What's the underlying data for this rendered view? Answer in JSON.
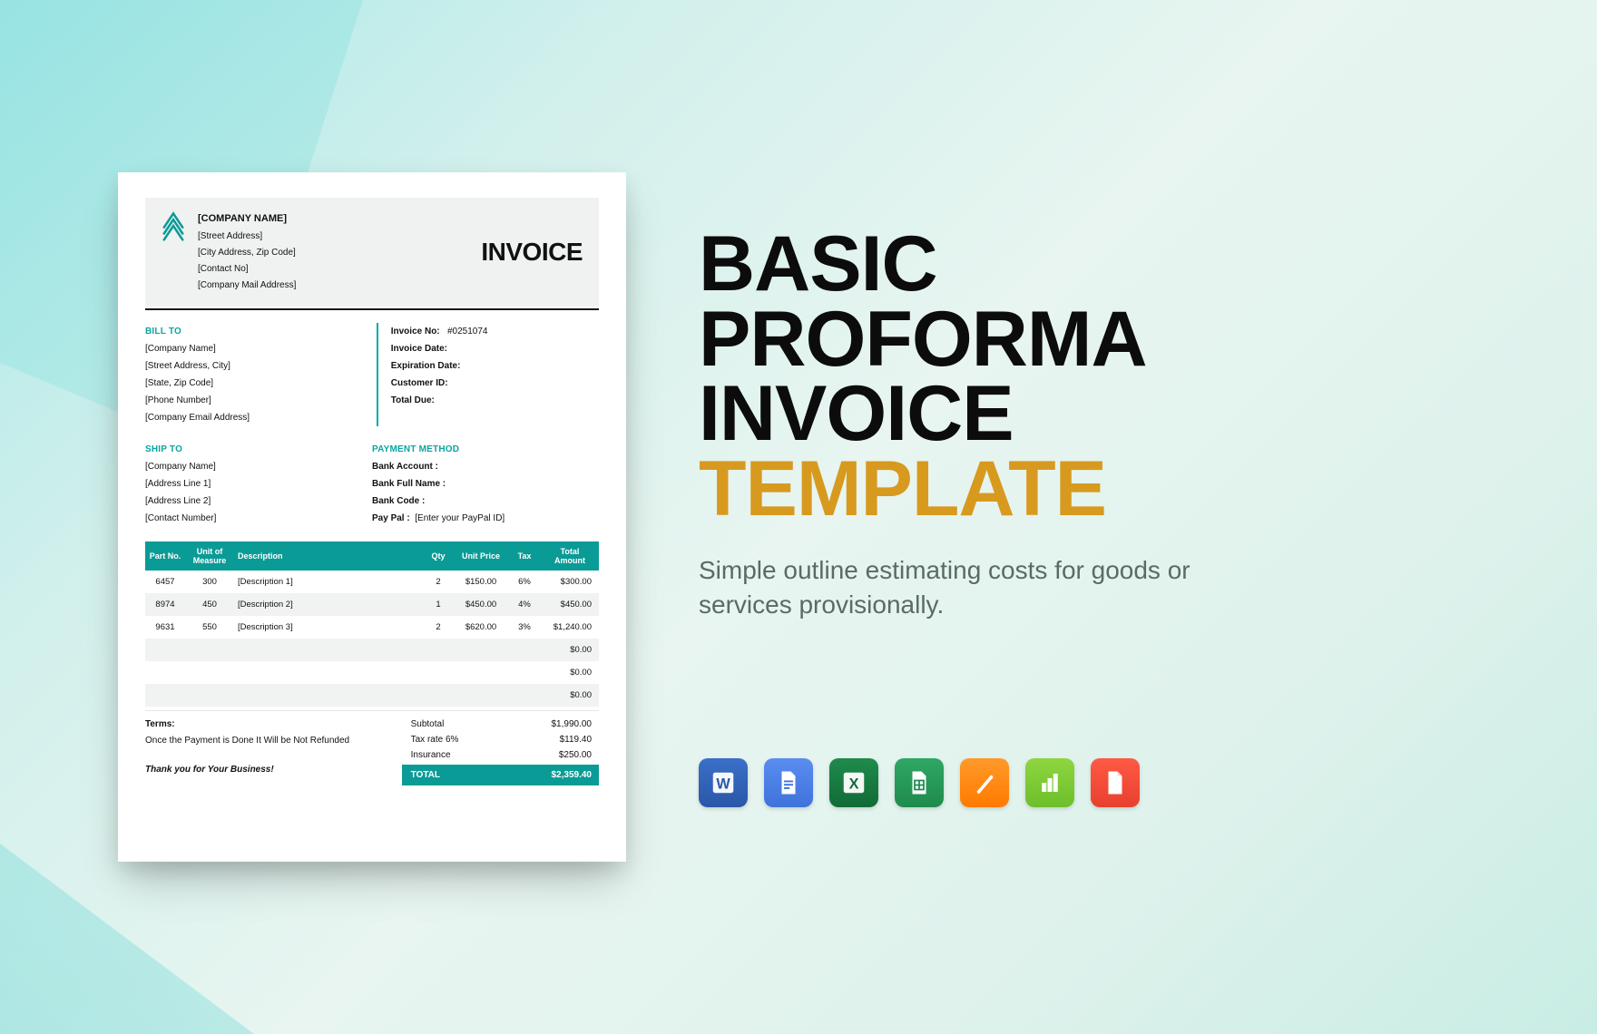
{
  "hero": {
    "title_line1": "Basic",
    "title_line2": "Proforma",
    "title_line3": "Invoice",
    "title_accent": "Template",
    "subtitle": "Simple outline estimating costs for goods or services provisionally."
  },
  "formats": {
    "word": "Word",
    "gdoc": "Google Docs",
    "excel": "Excel",
    "gsheet": "Google Sheets",
    "pages": "Pages",
    "numbers": "Numbers",
    "pdf": "PDF"
  },
  "invoice": {
    "heading": "INVOICE",
    "company": {
      "name": "[COMPANY NAME]",
      "street": "[Street Address]",
      "city": "[City Address, Zip Code]",
      "contact": "[Contact No]",
      "mail": "[Company Mail Address]"
    },
    "bill_to": {
      "label": "BILL TO",
      "lines": [
        "[Company Name]",
        "[Street Address, City]",
        "[State, Zip Code]",
        "[Phone Number]",
        "[Company Email Address]"
      ]
    },
    "meta": {
      "invoice_no_label": "Invoice No:",
      "invoice_no": "#0251074",
      "invoice_date_label": "Invoice Date:",
      "expiration_label": "Expiration Date:",
      "customer_id_label": "Customer ID:",
      "total_due_label": "Total Due:"
    },
    "ship_to": {
      "label": "SHIP TO",
      "lines": [
        "[Company Name]",
        "[Address Line 1]",
        "[Address Line 2]",
        "[Contact Number]"
      ]
    },
    "payment": {
      "label": "PAYMENT METHOD",
      "bank_account": "Bank Account :",
      "bank_name": "Bank Full Name :",
      "bank_code": "Bank Code :",
      "paypal_label": "Pay Pal :",
      "paypal_value": "[Enter your PayPal ID]"
    },
    "table": {
      "headers": {
        "part": "Part No.",
        "uom": "Unit of Measure",
        "desc": "Description",
        "qty": "Qty",
        "price": "Unit Price",
        "tax": "Tax",
        "amount": "Total Amount"
      },
      "rows": [
        {
          "part": "6457",
          "uom": "300",
          "desc": "[Description 1]",
          "qty": "2",
          "price": "$150.00",
          "tax": "6%",
          "amount": "$300.00"
        },
        {
          "part": "8974",
          "uom": "450",
          "desc": "[Description 2]",
          "qty": "1",
          "price": "$450.00",
          "tax": "4%",
          "amount": "$450.00"
        },
        {
          "part": "9631",
          "uom": "550",
          "desc": "[Description 3]",
          "qty": "2",
          "price": "$620.00",
          "tax": "3%",
          "amount": "$1,240.00"
        }
      ],
      "blank_amount": "$0.00"
    },
    "terms": {
      "label": "Terms:",
      "text": "Once the Payment is Done It Will be Not Refunded"
    },
    "summary": {
      "subtotal_label": "Subtotal",
      "subtotal": "$1,990.00",
      "taxrate_label": "Tax rate 6%",
      "taxrate": "$119.40",
      "insurance_label": "Insurance",
      "insurance": "$250.00",
      "total_label": "TOTAL",
      "total": "$2,359.40"
    },
    "thanks": "Thank you for Your Business!"
  }
}
